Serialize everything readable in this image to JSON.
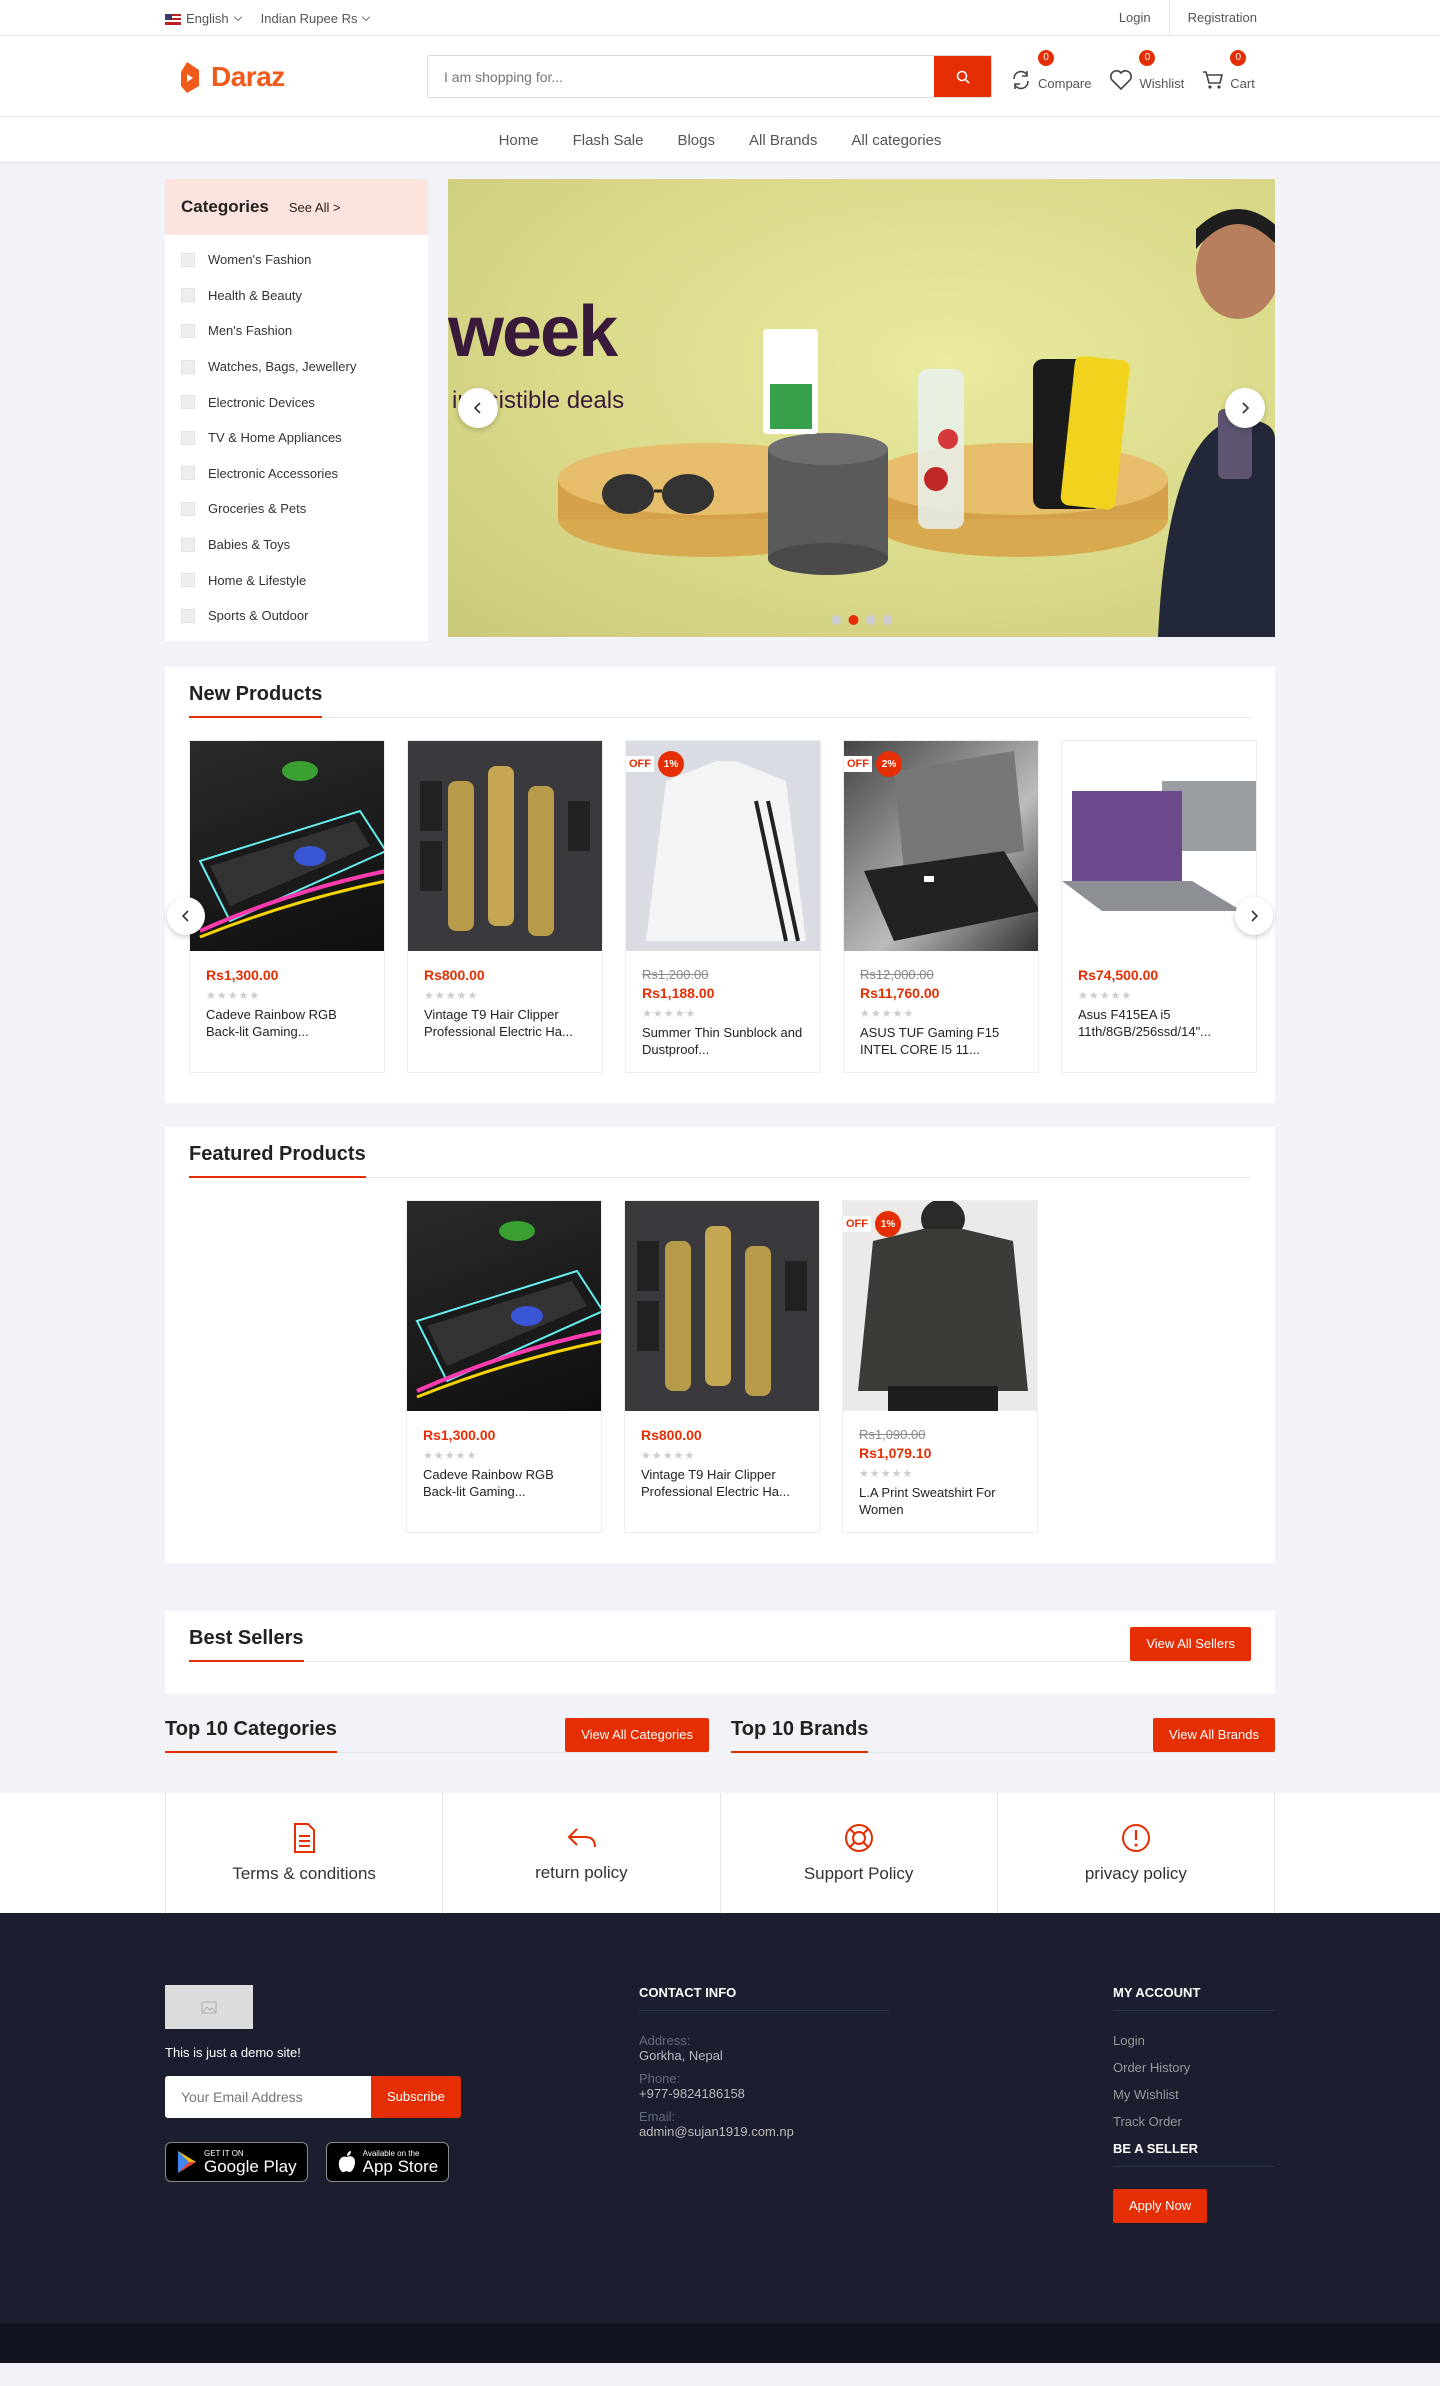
{
  "topbar": {
    "language": "English",
    "currency": "Indian Rupee Rs",
    "login": "Login",
    "registration": "Registration"
  },
  "header": {
    "logo_text": "Daraz",
    "search_placeholder": "I am shopping for...",
    "compare": {
      "label": "Compare",
      "count": "0"
    },
    "wishlist": {
      "label": "Wishlist",
      "count": "0"
    },
    "cart": {
      "label": "Cart",
      "count": "0"
    }
  },
  "nav": {
    "items": [
      "Home",
      "Flash Sale",
      "Blogs",
      "All Brands",
      "All categories"
    ]
  },
  "categories": {
    "title": "Categories",
    "see_all": "See All >",
    "items": [
      "Women's Fashion",
      "Health & Beauty",
      "Men's Fashion",
      "Watches, Bags, Jewellery",
      "Electronic Devices",
      "TV & Home Appliances",
      "Electronic Accessories",
      "Groceries & Pets",
      "Babies & Toys",
      "Home & Lifestyle",
      "Sports & Outdoor"
    ]
  },
  "slider": {
    "headline": "week",
    "subline": "irresistible deals",
    "active_dot": 2,
    "dot_count": 4
  },
  "new_products": {
    "title": "New Products",
    "items": [
      {
        "price": "Rs1,300.00",
        "old_price": "",
        "off": "",
        "name": "Cadeve Rainbow RGB Back-lit Gaming...",
        "image": "keyboard"
      },
      {
        "price": "Rs800.00",
        "old_price": "",
        "off": "",
        "name": "Vintage T9 Hair Clipper Professional Electric Ha...",
        "image": "clipper"
      },
      {
        "price": "Rs1,188.00",
        "old_price": "Rs1,200.00",
        "off": "1%",
        "name": "Summer Thin Sunblock and Dustproof...",
        "image": "jacket"
      },
      {
        "price": "Rs11,760.00",
        "old_price": "Rs12,000.00",
        "off": "2%",
        "name": "ASUS TUF Gaming F15 INTEL CORE I5 11...",
        "image": "laptop-dark"
      },
      {
        "price": "Rs74,500.00",
        "old_price": "",
        "off": "",
        "name": "Asus F415EA i5 11th/8GB/256ssd/14\"...",
        "image": "laptop-grey"
      }
    ]
  },
  "featured_products": {
    "title": "Featured Products",
    "items": [
      {
        "price": "Rs1,300.00",
        "old_price": "",
        "off": "",
        "name": "Cadeve Rainbow RGB Back-lit Gaming...",
        "image": "keyboard"
      },
      {
        "price": "Rs800.00",
        "old_price": "",
        "off": "",
        "name": "Vintage T9 Hair Clipper Professional Electric Ha...",
        "image": "clipper"
      },
      {
        "price": "Rs1,079.10",
        "old_price": "Rs1,090.00",
        "off": "1%",
        "name": "L.A Print Sweatshirt For Women",
        "image": "sweatshirt"
      }
    ]
  },
  "off_label": "OFF",
  "best_sellers": {
    "title": "Best Sellers",
    "button": "View All Sellers"
  },
  "top_categories": {
    "title": "Top 10 Categories",
    "button": "View All Categories"
  },
  "top_brands": {
    "title": "Top 10 Brands",
    "button": "View All Brands"
  },
  "policies": [
    {
      "label": "Terms & conditions",
      "icon": "document-icon"
    },
    {
      "label": "return policy",
      "icon": "reply-icon"
    },
    {
      "label": "Support Policy",
      "icon": "lifebuoy-icon"
    },
    {
      "label": "privacy policy",
      "icon": "alert-icon"
    }
  ],
  "footer": {
    "demo_text": "This is just a demo site!",
    "email_placeholder": "Your Email Address",
    "subscribe": "Subscribe",
    "google_play_small": "GET IT ON",
    "google_play_big": "Google Play",
    "app_store_small": "Available on the",
    "app_store_big": "App Store",
    "contact": {
      "title": "CONTACT INFO",
      "address_label": "Address:",
      "address": "Gorkha, Nepal",
      "phone_label": "Phone:",
      "phone": "+977-9824186158",
      "email_label": "Email:",
      "email": "admin@sujan1919.com.np"
    },
    "account": {
      "title": "MY ACCOUNT",
      "links": [
        "Login",
        "Order History",
        "My Wishlist",
        "Track Order"
      ]
    },
    "seller": {
      "title": "BE A SELLER",
      "button": "Apply Now"
    }
  },
  "colors": {
    "accent": "#e62e04",
    "footer_bg": "#1b1e2e",
    "category_head": "#fde3de"
  }
}
